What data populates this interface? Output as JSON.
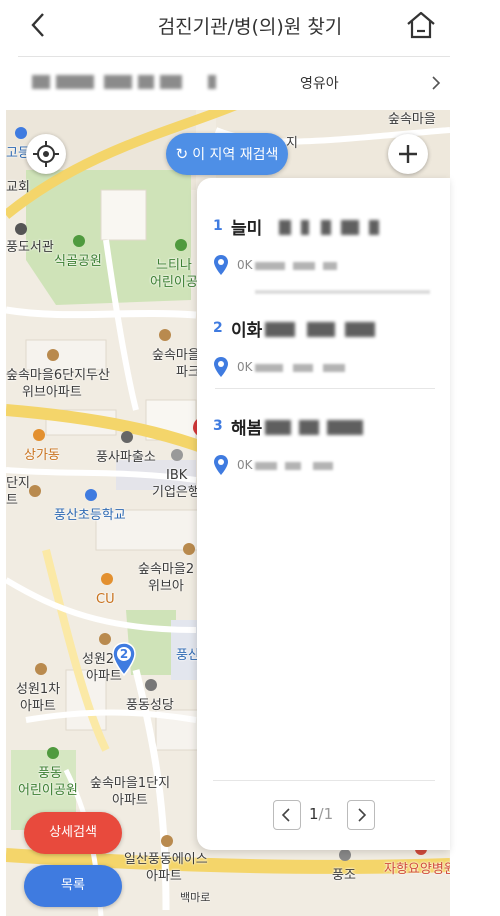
{
  "header": {
    "title": "검진기관/병(의)원 찾기"
  },
  "subbar": {
    "tag": "영유아"
  },
  "map": {
    "research_label": "이 지역 재검색",
    "labels": [
      {
        "text": "숲속마을",
        "style": ""
      },
      {
        "text": "지",
        "style": ""
      },
      {
        "text": "고등",
        "style": "b"
      },
      {
        "text": "교회",
        "style": ""
      },
      {
        "text": "풍도서관",
        "style": ""
      },
      {
        "text": "식골공원",
        "style": "g"
      },
      {
        "text": "느티나",
        "style": "g"
      },
      {
        "text": "어린이공",
        "style": "g"
      },
      {
        "text": "숲속마을",
        "style": ""
      },
      {
        "text": "파크",
        "style": ""
      },
      {
        "text": "숲속마을6단지두산",
        "style": ""
      },
      {
        "text": "위브아파트",
        "style": ""
      },
      {
        "text": "상가동",
        "style": "o"
      },
      {
        "text": "풍사파출소",
        "style": ""
      },
      {
        "text": "IBK",
        "style": ""
      },
      {
        "text": "기업은행",
        "style": ""
      },
      {
        "text": "단지",
        "style": ""
      },
      {
        "text": "트",
        "style": ""
      },
      {
        "text": "풍산초등학교",
        "style": "b"
      },
      {
        "text": "숲속마을2",
        "style": ""
      },
      {
        "text": "위브아",
        "style": ""
      },
      {
        "text": "CU",
        "style": "o"
      },
      {
        "text": "성원2",
        "style": ""
      },
      {
        "text": "아파트",
        "style": ""
      },
      {
        "text": "풍산",
        "style": "b"
      },
      {
        "text": "성원1차",
        "style": ""
      },
      {
        "text": "아파트",
        "style": ""
      },
      {
        "text": "풍동성당",
        "style": ""
      },
      {
        "text": "풍동",
        "style": "g"
      },
      {
        "text": "어린이공원",
        "style": "g"
      },
      {
        "text": "숲속마을1단지",
        "style": ""
      },
      {
        "text": "아파트",
        "style": ""
      },
      {
        "text": "일산풍동에이스",
        "style": ""
      },
      {
        "text": "아파트",
        "style": ""
      },
      {
        "text": "풍조",
        "style": ""
      },
      {
        "text": "자향요양병원",
        "style": "r"
      },
      {
        "text": "백마로",
        "style": ""
      }
    ],
    "marker_number": "2"
  },
  "results": [
    {
      "num": "1",
      "name": "늘미",
      "addr": "0K"
    },
    {
      "num": "2",
      "name": "이화",
      "addr": "0K"
    },
    {
      "num": "3",
      "name": "해봄",
      "addr": "0K"
    }
  ],
  "pager": {
    "current": "1",
    "total": "1",
    "sep": "/"
  },
  "buttons": {
    "detail_search": "상세검색",
    "list": "목록"
  },
  "colors": {
    "primary": "#3f7be0",
    "accent_red": "#e84a3d",
    "research_blue": "#4e8fe6"
  }
}
